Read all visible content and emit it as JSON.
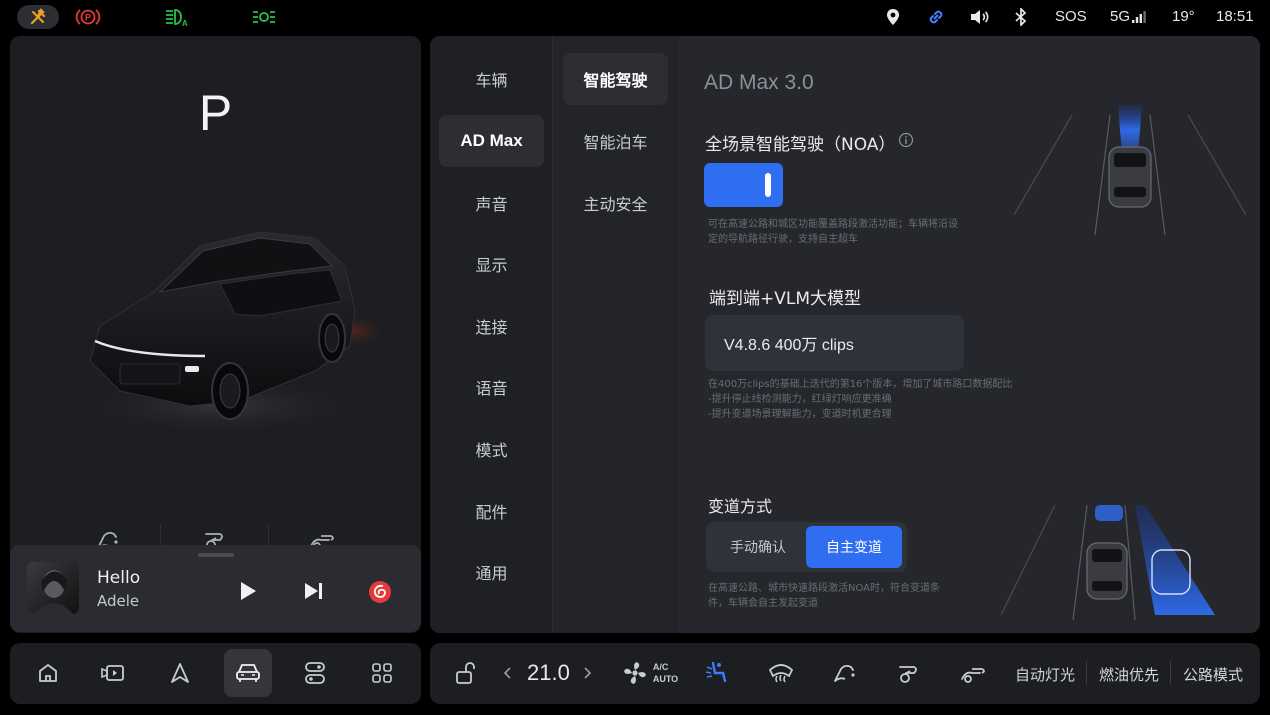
{
  "status_bar": {
    "icons_left": [
      "wrench-icon",
      "parking-brake-icon",
      "auto-high-beam-icon",
      "position-light-icon"
    ],
    "icons_right": [
      "location-icon",
      "link-icon",
      "volume-icon",
      "bluetooth-icon"
    ],
    "sos": "SOS",
    "network": "5G",
    "temperature": "19°",
    "time": "18:51",
    "colors": {
      "wrench": "#f0a020",
      "parking": "#e53935",
      "lights": "#27c24a",
      "link": "#4d7cff"
    }
  },
  "vehicle": {
    "gear": "P",
    "mirror_buttons": [
      "mirror-fold-icon",
      "mirror-left-icon",
      "mirror-right-icon"
    ]
  },
  "media": {
    "song": "Hello",
    "artist": "Adele",
    "controls": [
      "play-icon",
      "next-track-icon",
      "netease-music-icon"
    ]
  },
  "settings_nav": {
    "primary": [
      "车辆",
      "AD Max",
      "声音",
      "显示",
      "连接",
      "语音",
      "模式",
      "配件",
      "通用"
    ],
    "primary_selected": "AD Max",
    "secondary": [
      "智能驾驶",
      "智能泊车",
      "主动安全"
    ],
    "secondary_selected": "智能驾驶"
  },
  "ad_max": {
    "title": "AD Max 3.0",
    "noa": {
      "label": "全场景智能驾驶（NOA）",
      "enabled": true,
      "desc_line1": "可在高速公路和城区功能覆盖路段激活功能；车辆将沿设",
      "desc_line2": "定的导航路径行驶，支持自主超车"
    },
    "model": {
      "label": "端到端+VLM大模型",
      "version": "V4.8.6  400万 clips",
      "desc_line1": "在400万clips的基础上迭代的第16个版本，增加了城市路口数据配比",
      "desc_line2": "-提升停止线检测能力，红绿灯响应更准确",
      "desc_line3": "-提升变道场景理解能力，变道时机更合理"
    },
    "lane_change": {
      "label": "变道方式",
      "options": [
        "手动确认",
        "自主变道"
      ],
      "selected": "自主变道",
      "desc_line1": "在高速公路、城市快速路段激活NOA时，符合变道条",
      "desc_line2": "件，车辆会自主发起变道"
    },
    "accent": "#2f6ef0"
  },
  "dock": {
    "apps": [
      "home-icon",
      "media-icon",
      "navigation-icon",
      "vehicle-icon",
      "controls-icon",
      "apps-grid-icon"
    ],
    "selected": "vehicle-icon"
  },
  "climate_bar": {
    "temperature": "21.0",
    "ac_label_top": "A/C",
    "ac_label_bottom": "AUTO",
    "quick_actions": [
      "自动灯光",
      "燃油优先",
      "公路模式"
    ]
  }
}
